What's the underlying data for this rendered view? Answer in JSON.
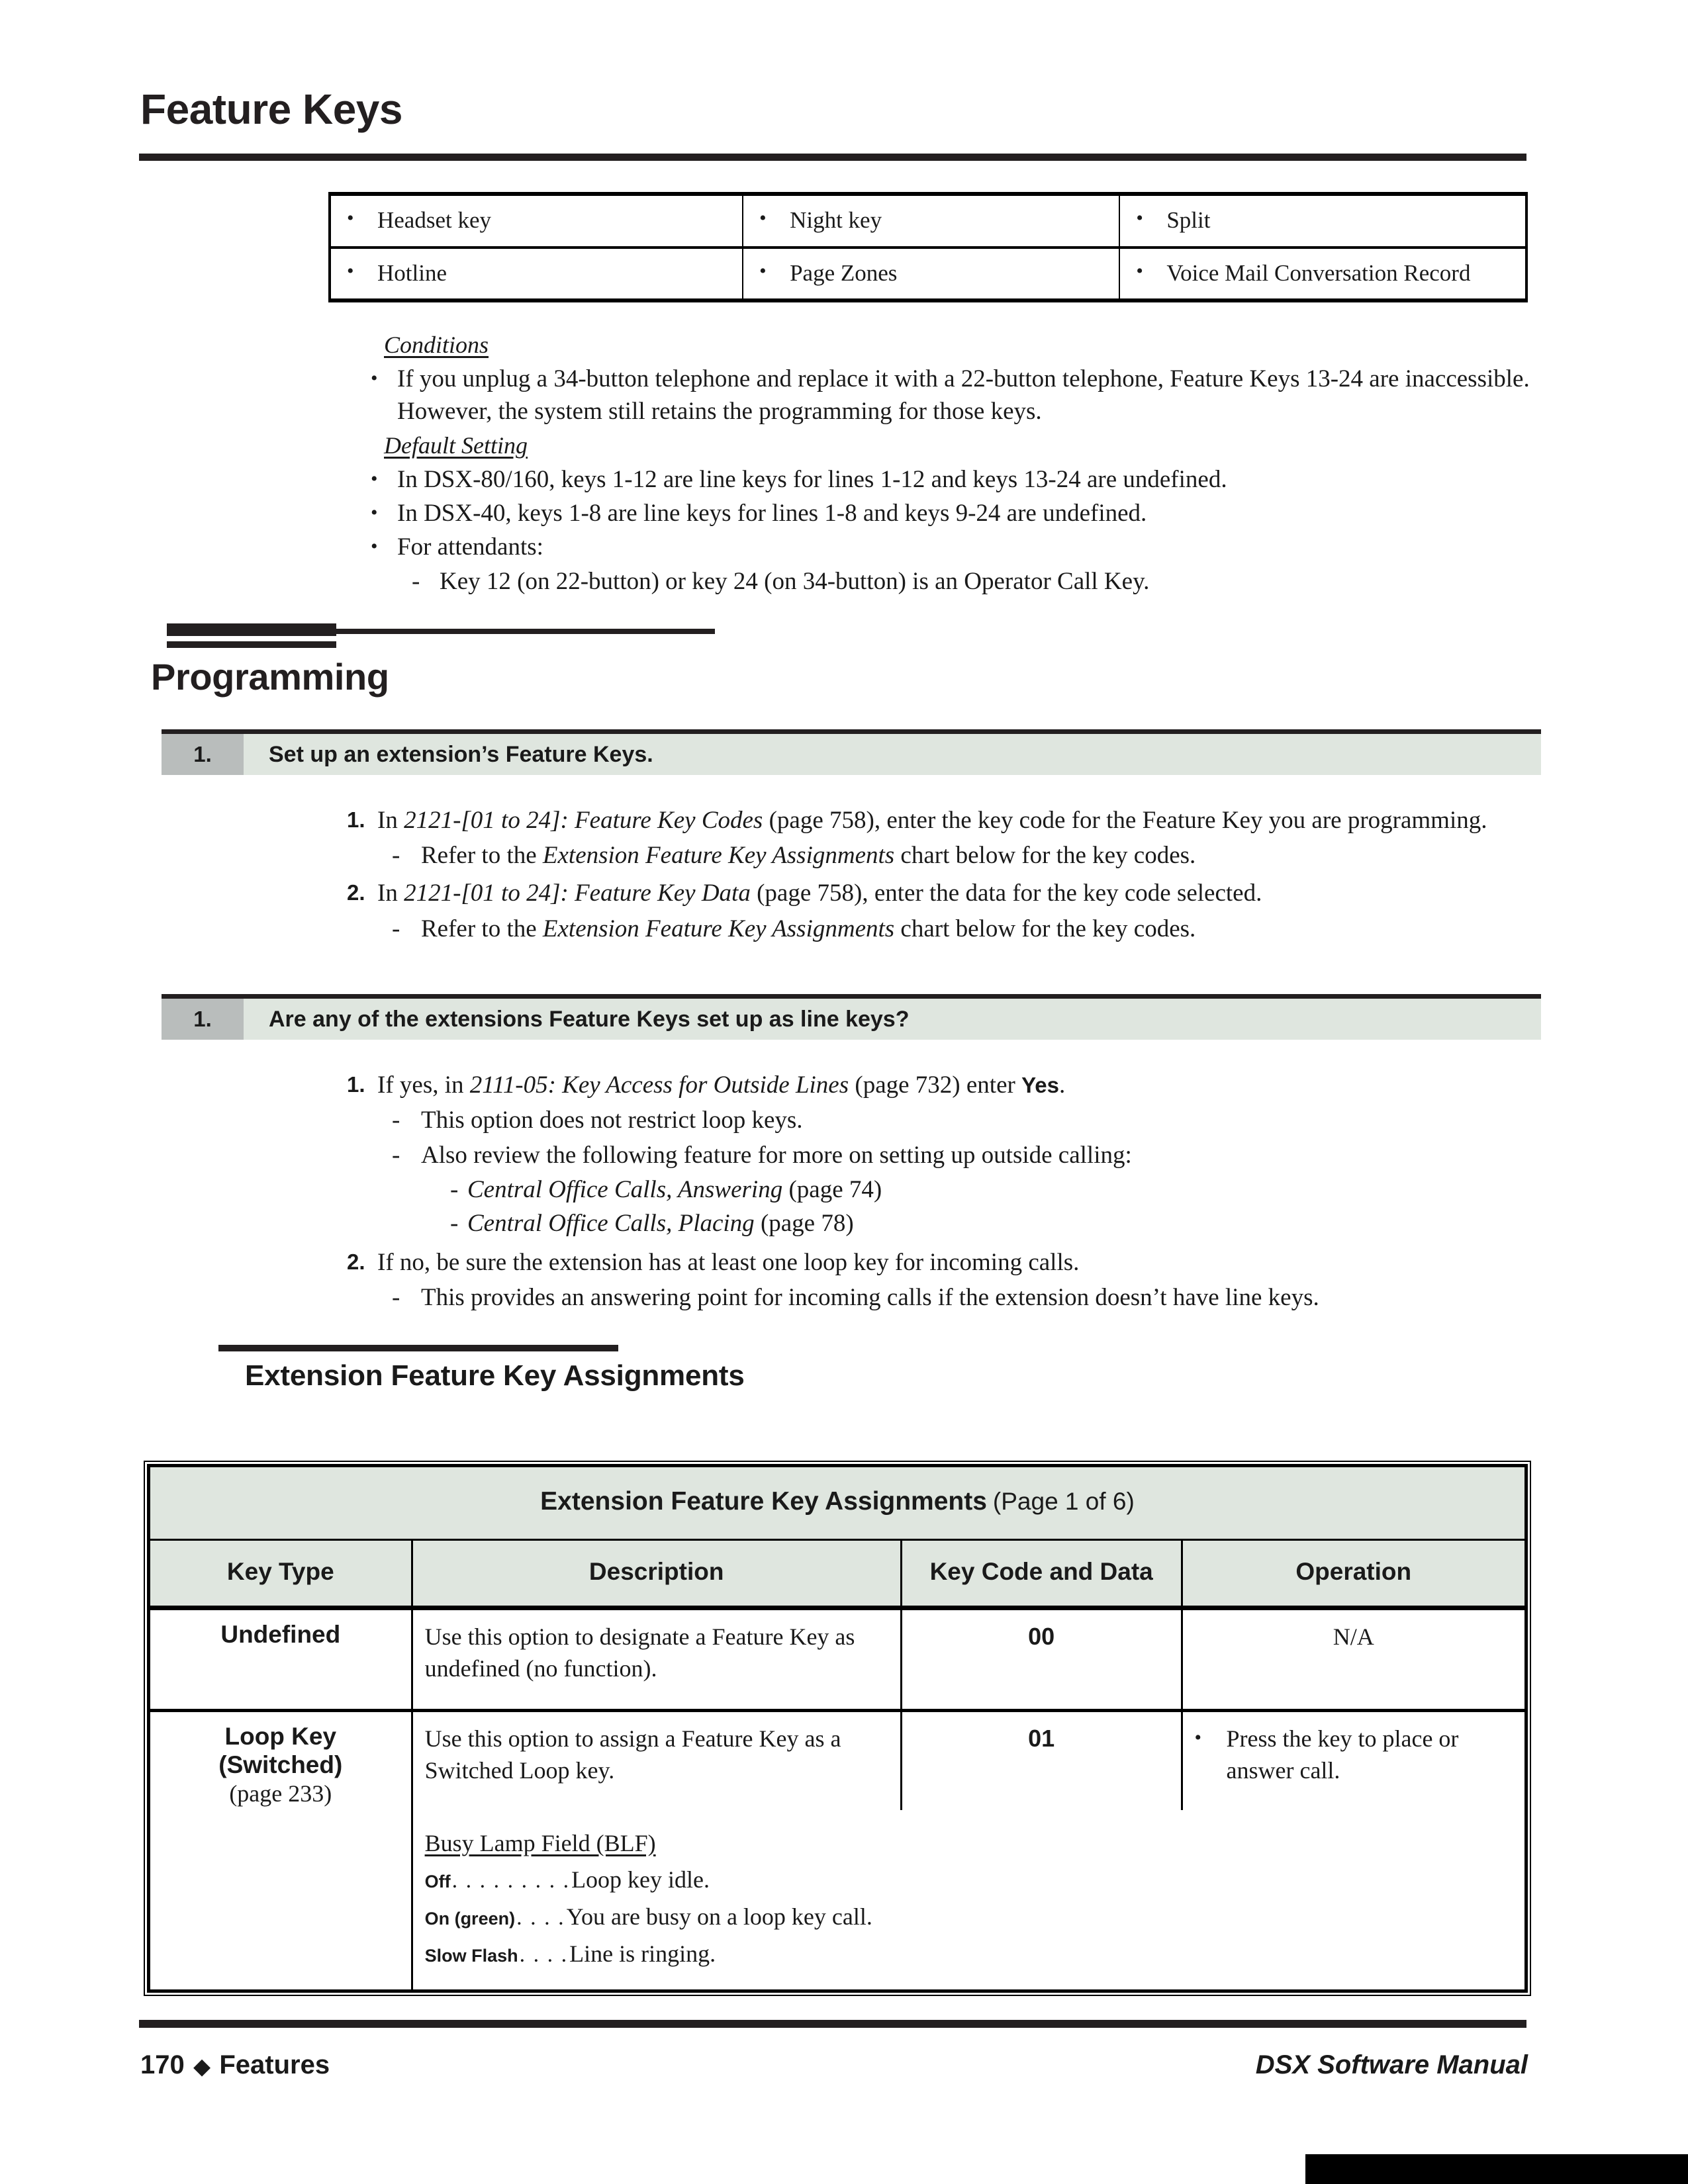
{
  "header": {
    "title": "Feature Keys"
  },
  "feature_grid": {
    "rows": [
      [
        "Headset key",
        "Night key",
        "Split"
      ],
      [
        "Hotline",
        "Page Zones",
        "Voice Mail Conversation Record"
      ]
    ]
  },
  "conditions": {
    "label": "Conditions",
    "items": [
      "If you unplug a 34-button telephone and replace it with a 22-button telephone, Feature Keys 13-24 are inaccessible. However, the system still retains the programming for those keys."
    ]
  },
  "default_setting": {
    "label": "Default Setting",
    "items": [
      "In DSX-80/160, keys 1-12 are line keys for lines 1-12 and keys 13-24 are undefined.",
      "In DSX-40, keys 1-8 are line keys for lines 1-8 and keys 9-24 are undefined.",
      "For attendants:"
    ],
    "sub_item": "Key 12 (on 22-button) or key 24 (on 34-button) is an Operator Call Key."
  },
  "programming": {
    "title": "Programming",
    "steps": [
      {
        "number": "1.",
        "heading": "Set up an extension’s Feature Keys.",
        "items": [
          {
            "number": "1.",
            "pre": "In ",
            "italic": "2121-[01 to 24]: Feature Key Codes",
            "post": " (page 758), enter the key code for the Feature Key you are programming.",
            "sub": {
              "pre": "Refer to the ",
              "italic": "Extension Feature Key Assignments",
              "post": " chart below for the key codes."
            }
          },
          {
            "number": "2.",
            "pre": "In ",
            "italic": "2121-[01 to 24]: Feature Key Data",
            "post": " (page 758), enter the data for the key code selected.",
            "sub": {
              "pre": "Refer to the ",
              "italic": "Extension Feature Key Assignments",
              "post": " chart below for the key codes."
            }
          }
        ]
      },
      {
        "number": "1.",
        "heading": "Are any of the extensions Feature Keys set up as line keys?",
        "items": [
          {
            "number": "1.",
            "pre": "If yes, in ",
            "italic": "2111-05: Key Access for Outside Lines",
            "post": " (page 732) enter ",
            "bold": "Yes",
            "tail": ".",
            "subs": [
              "This option does not restrict loop keys.",
              "Also review the following feature for more on setting up outside calling:"
            ],
            "refs": [
              {
                "italic": "Central Office Calls, Answering",
                "post": " (page 74)"
              },
              {
                "italic": "Central Office Calls, Placing",
                "post": " (page 78)"
              }
            ]
          },
          {
            "number": "2.",
            "pre": "If no, be sure the extension has at least one loop key for incoming calls.",
            "subs": [
              "This provides an answering point for incoming calls if the extension doesn’t have line keys."
            ]
          }
        ]
      }
    ]
  },
  "assignments_section": {
    "heading": "Extension Feature Key Assignments"
  },
  "assignments_table": {
    "caption_main": "Extension Feature Key Assignments",
    "caption_sub": "(Page 1 of 6)",
    "columns": [
      "Key Type",
      "Description",
      "Key Code and Data",
      "Operation"
    ],
    "rows": [
      {
        "key_type": "Undefined",
        "key_type_page": "",
        "description": "Use this option to designate a Feature Key as undefined (no function).",
        "code": "00",
        "operation_plain": "N/A"
      },
      {
        "key_type": "Loop Key\n(Switched)",
        "key_type_page": "(page 233)",
        "description": "Use this option to assign a Feature Key as a Switched Loop key.",
        "code": "01",
        "operation_bullet": "Press the key to place or answer call."
      }
    ],
    "blf": {
      "title": "Busy Lamp Field (BLF)",
      "rows": [
        {
          "label": "Off",
          "dots": ". . . . . . . . .",
          "text": "Loop key idle."
        },
        {
          "label": "On (green)",
          "dots": ". . . .",
          "text": "You are busy on a loop key call."
        },
        {
          "label": "Slow Flash",
          "dots": ". . . .",
          "text": "Line is ringing."
        }
      ]
    }
  },
  "footer": {
    "page_number": "170",
    "diamond": "◆",
    "section": "Features",
    "manual": "DSX Software Manual"
  }
}
